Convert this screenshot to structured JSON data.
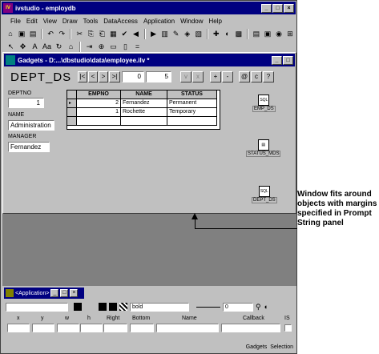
{
  "main_window": {
    "title": "ivstudio - employdb",
    "app_icon_text": "IV"
  },
  "window_controls": {
    "minimize": "_",
    "restore": "□",
    "close": "×"
  },
  "menu": [
    "File",
    "Edit",
    "View",
    "Draw",
    "Tools",
    "DataAccess",
    "Application",
    "Window",
    "Help"
  ],
  "toolbar1": [
    "⌂",
    "▣",
    "▤",
    "↶",
    "↷",
    "✂",
    "⎘",
    "⎗",
    "▦",
    "✔",
    "◀",
    "▶",
    "▥",
    "✎",
    "◈",
    "▧",
    "✚",
    "◐",
    "▩",
    "▤",
    "▣",
    "◉",
    "⊞"
  ],
  "toolbar2": [
    "↖",
    "✥",
    "A",
    "Aa",
    "↻",
    "⌂",
    "⇥",
    "⊕",
    "▭",
    "▯",
    "="
  ],
  "gadgets_window": {
    "title": "Gadgets - D:...\\dbstudio\\data\\employee.ilv *"
  },
  "dataset": {
    "title": "DEPT_DS",
    "nav": {
      "first": "|<",
      "prev": "<",
      "next": ">",
      "last": ">|",
      "current": "0",
      "count": "5",
      "validate": "v",
      "cancel": "x",
      "insert": "+",
      "delete": "-",
      "at": "@",
      "c": "c",
      "help": "?"
    }
  },
  "form": {
    "deptno_label": "DEPTNO",
    "deptno_value": "1",
    "name_label": "NAME",
    "name_value": "Administration",
    "manager_label": "MANAGER",
    "manager_value": "Fernandez"
  },
  "table": {
    "columns": [
      "EMPNO",
      "NAME",
      "STATUS"
    ],
    "rows": [
      {
        "marker": "▸",
        "cells": [
          "2",
          "Fernandez",
          "Permanent"
        ]
      },
      {
        "marker": "",
        "cells": [
          "1",
          "Rochette",
          "Temporary"
        ]
      },
      {
        "marker": "",
        "cells": [
          "",
          "",
          ""
        ]
      }
    ]
  },
  "ds_widgets": [
    {
      "icon": "SQL",
      "label": "EMP_DS"
    },
    {
      "icon": "▤",
      "label": "STATUS_MDS"
    },
    {
      "icon": "SQL",
      "label": "DEPT_DS"
    }
  ],
  "app_window": {
    "title": "<Application>",
    "font_style": "bold",
    "line_width": "0",
    "prop_labels": [
      "x",
      "y",
      "w",
      "h",
      "Right",
      "Bottom",
      "Name",
      "Callback",
      "IS"
    ]
  },
  "status_bar": [
    "Gadgets",
    "Selection"
  ],
  "callout": {
    "line1": "Window fits around",
    "line2": "objects with margins",
    "line3": "specified in Prompt",
    "line4": "String panel"
  }
}
